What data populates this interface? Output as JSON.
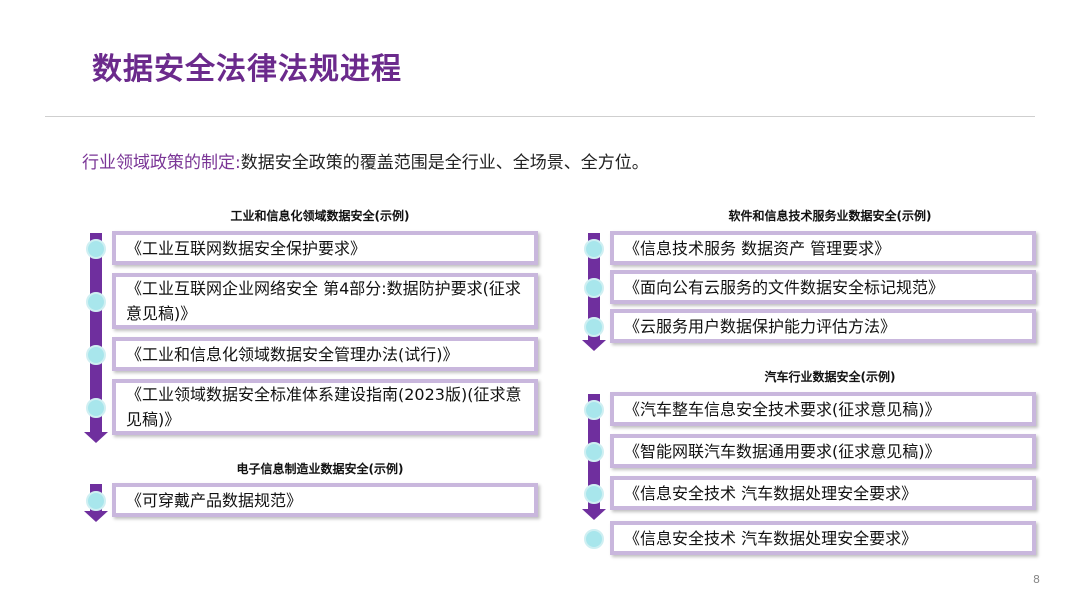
{
  "title": "数据安全法律法规进程",
  "subtitle": {
    "label": "行业领域政策的制定:",
    "text": "数据安全政策的覆盖范围是全行业、全场景、全方位。"
  },
  "sections": {
    "industrial": {
      "heading": "工业和信息化领域数据安全(示例)",
      "items": [
        "《工业互联网数据安全保护要求》",
        "《工业互联网企业网络安全 第4部分:数据防护要求(征求意见稿)》",
        "《工业和信息化领域数据安全管理办法(试行)》",
        "《工业领域数据安全标准体系建设指南(2023版)(征求意见稿)》"
      ]
    },
    "electronic": {
      "heading": "电子信息制造业数据安全(示例)",
      "items": [
        "《可穿戴产品数据规范》"
      ]
    },
    "software": {
      "heading": "软件和信息技术服务业数据安全(示例)",
      "items": [
        "《信息技术服务 数据资产 管理要求》",
        "《面向公有云服务的文件数据安全标记规范》",
        "《云服务用户数据保护能力评估方法》"
      ]
    },
    "auto": {
      "heading": "汽车行业数据安全(示例)",
      "items": [
        "《汽车整车信息安全技术要求(征求意见稿)》",
        "《智能网联汽车数据通用要求(征求意见稿)》",
        "《信息安全技术 汽车数据处理安全要求》",
        "《信息安全技术 汽车数据处理安全要求》"
      ]
    }
  },
  "page_number": "8",
  "colors": {
    "title": "#6b2a8c",
    "bar": "#6f2f9e",
    "card_border": "#c9b7dd",
    "dot": "#a8e6ec"
  }
}
